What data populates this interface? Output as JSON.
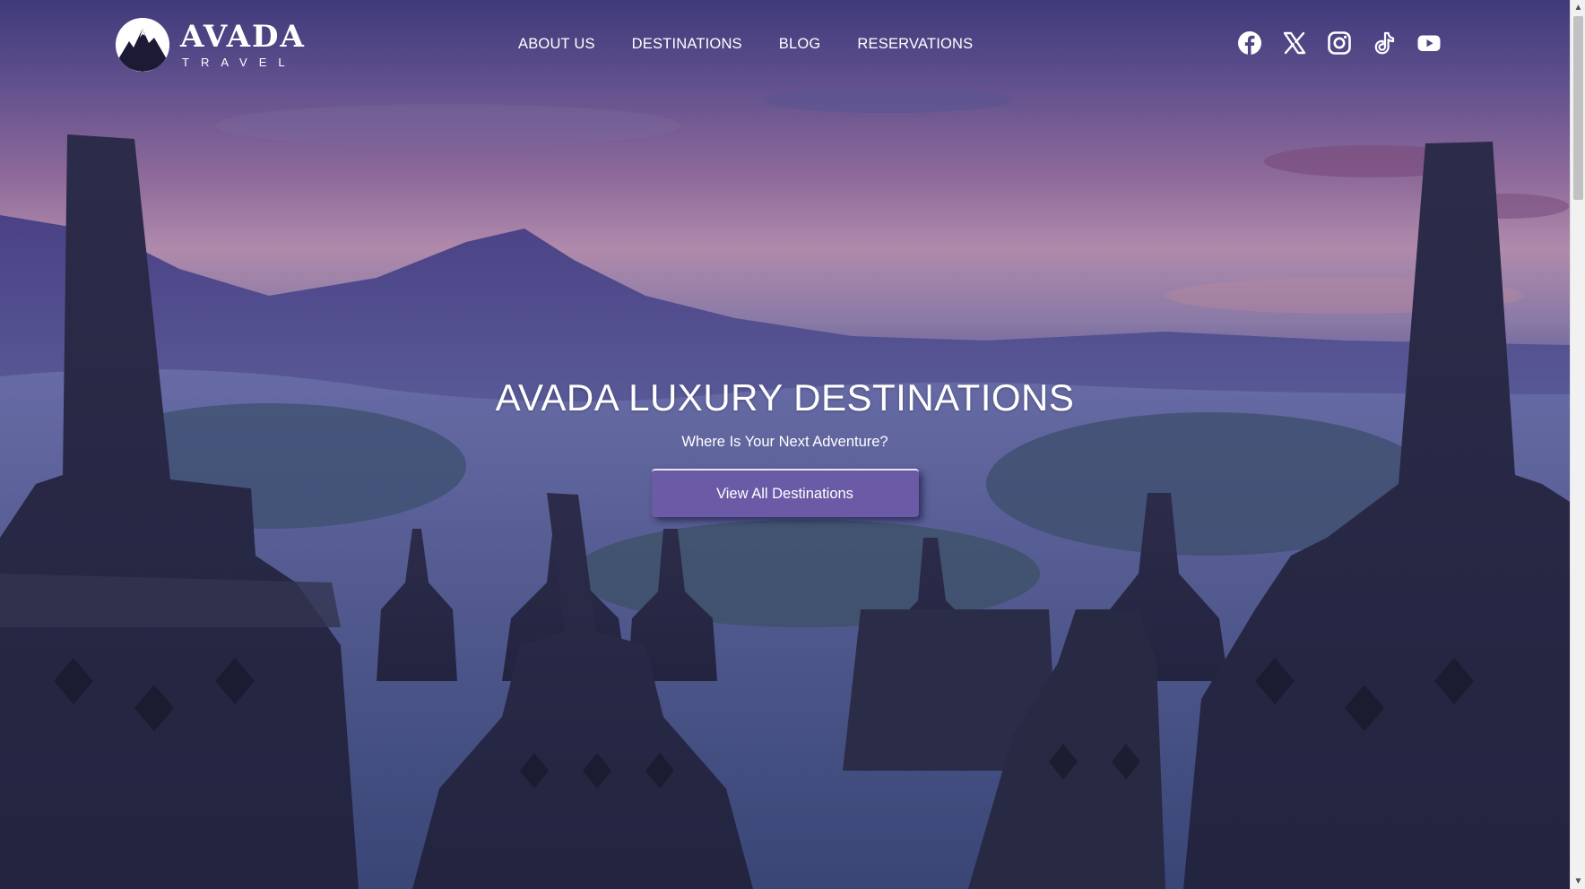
{
  "brand": {
    "name": "AVADA",
    "tagline": "TRAVEL"
  },
  "nav": {
    "items": [
      {
        "label": "ABOUT US"
      },
      {
        "label": "DESTINATIONS"
      },
      {
        "label": "BLOG"
      },
      {
        "label": "RESERVATIONS"
      }
    ]
  },
  "social": [
    "facebook-icon",
    "x-twitter-icon",
    "instagram-icon",
    "tiktok-icon",
    "youtube-icon"
  ],
  "hero": {
    "title": "AVADA LUXURY DESTINATIONS",
    "subtitle": "Where Is Your Next Adventure?",
    "cta_label": "View All Destinations"
  },
  "colors": {
    "accent": "#6b5aa6",
    "text": "#ffffff",
    "sky_top": "#3f3a7a",
    "sky_glow": "#b08aab"
  }
}
